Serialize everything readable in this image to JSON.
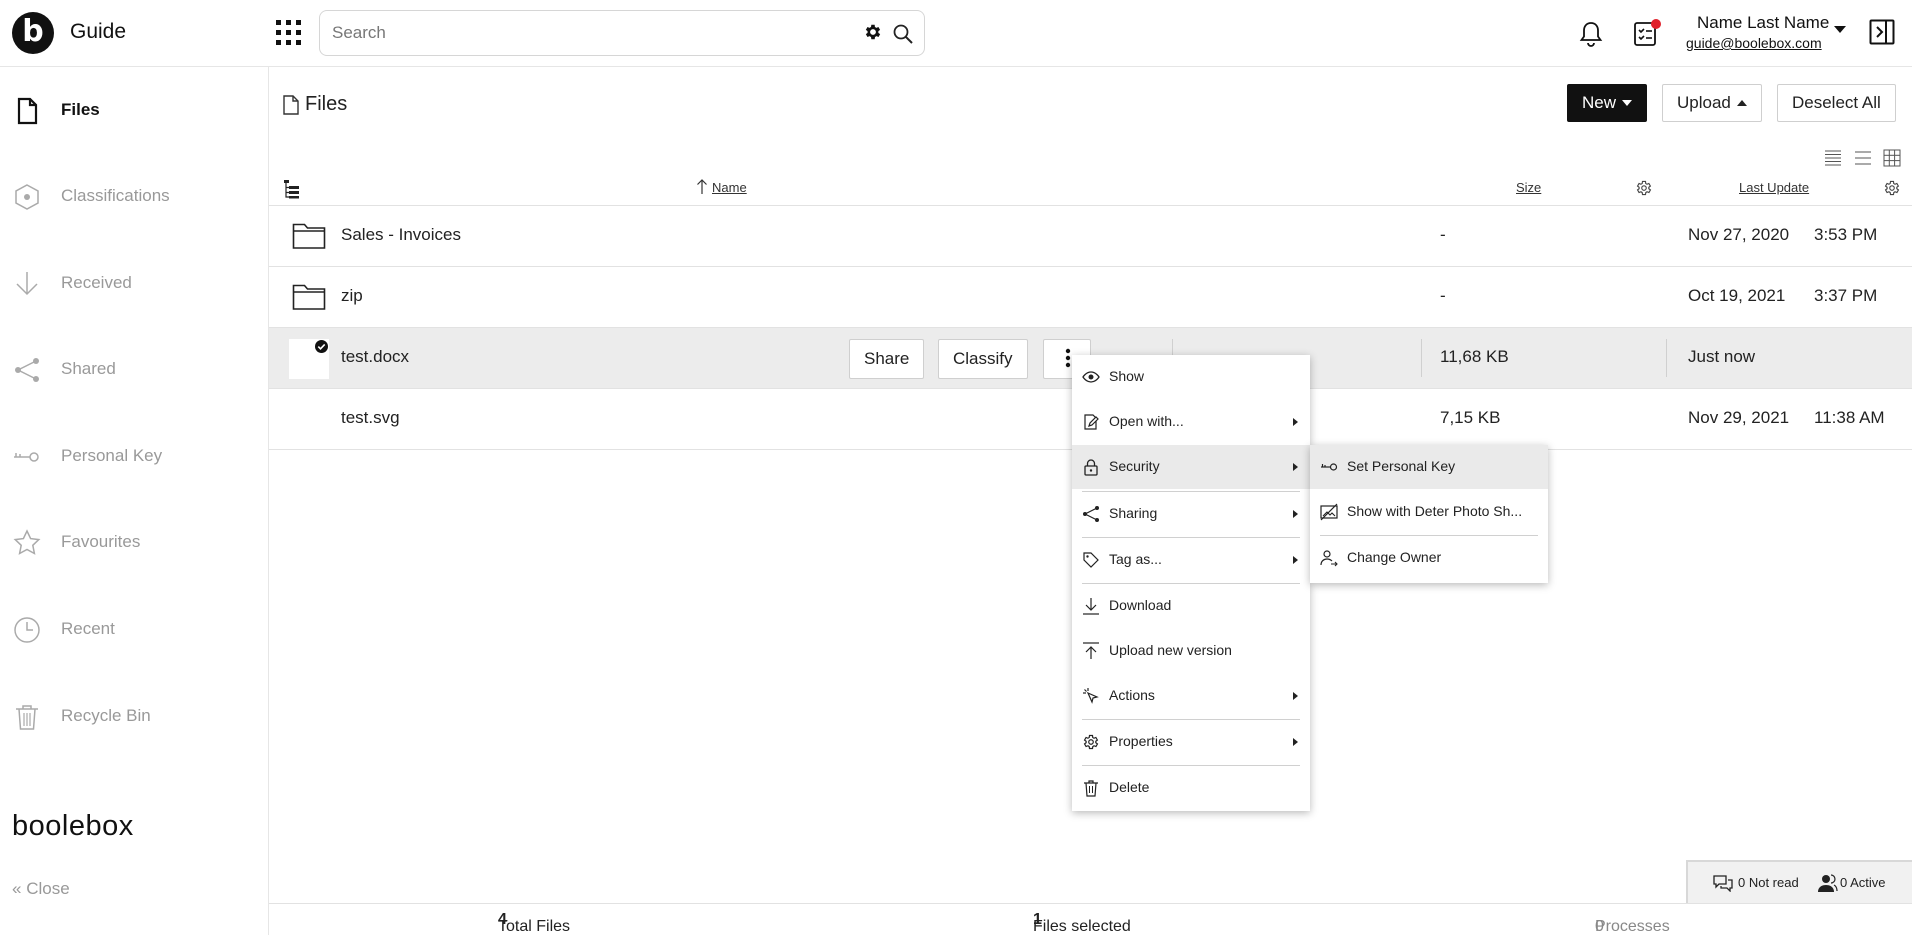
{
  "header": {
    "logo_letter": "b",
    "app_title": "Guide",
    "search_placeholder": "Search",
    "user_name": "Name Last Name",
    "user_email": "guide@boolebox.com"
  },
  "sidebar": {
    "items": [
      {
        "label": "Files",
        "icon": "file-icon",
        "active": true
      },
      {
        "label": "Classifications",
        "icon": "hexagon-icon"
      },
      {
        "label": "Received",
        "icon": "arrow-down-icon"
      },
      {
        "label": "Shared",
        "icon": "share-icon"
      },
      {
        "label": "Personal Key",
        "icon": "key-icon"
      },
      {
        "label": "Favourites",
        "icon": "star-icon"
      },
      {
        "label": "Recent",
        "icon": "clock-icon"
      },
      {
        "label": "Recycle Bin",
        "icon": "trash-icon"
      }
    ],
    "brand": "boolebox",
    "close_label": "Close"
  },
  "main": {
    "page_title": "Files",
    "new_label": "New",
    "upload_label": "Upload",
    "deselect_label": "Deselect All",
    "columns": {
      "name": "Name",
      "size": "Size",
      "last_update": "Last Update"
    },
    "rows": [
      {
        "name": "Sales - Invoices",
        "type": "folder",
        "size": "-",
        "date": "Nov 27, 2020",
        "time": "3:53 PM"
      },
      {
        "name": "zip",
        "type": "folder",
        "size": "-",
        "date": "Oct 19, 2021",
        "time": "3:37 PM"
      },
      {
        "name": "test.docx",
        "type": "file",
        "size": "11,68 KB",
        "date": "Just now",
        "time": "",
        "selected": true
      },
      {
        "name": "test.svg",
        "type": "file",
        "size": "7,15 KB",
        "date": "Nov 29, 2021",
        "time": "11:38 AM"
      }
    ],
    "row_share_label": "Share",
    "row_classify_label": "Classify"
  },
  "context_menu": {
    "items": [
      {
        "label": "Show",
        "icon": "eye-icon"
      },
      {
        "label": "Open with...",
        "icon": "edit-icon",
        "submenu": true
      },
      {
        "label": "Security",
        "icon": "lock-icon",
        "submenu": true,
        "highlighted": true
      },
      {
        "label": "Sharing",
        "icon": "share-icon",
        "submenu": true
      },
      {
        "label": "Tag as...",
        "icon": "tag-icon",
        "submenu": true
      },
      {
        "label": "Download",
        "icon": "download-icon"
      },
      {
        "label": "Upload new version",
        "icon": "upload-icon"
      },
      {
        "label": "Actions",
        "icon": "cursor-icon",
        "submenu": true
      },
      {
        "label": "Properties",
        "icon": "gear-icon",
        "submenu": true
      },
      {
        "label": "Delete",
        "icon": "trash-icon"
      }
    ]
  },
  "security_submenu": {
    "items": [
      {
        "label": "Set Personal Key",
        "icon": "key-icon",
        "highlighted": true
      },
      {
        "label": "Show with Deter Photo Sh...",
        "icon": "photo-off-icon"
      },
      {
        "label": "Change Owner",
        "icon": "user-change-icon"
      }
    ]
  },
  "footer": {
    "total_files_label": "Total Files",
    "total_files": "4",
    "files_selected_label": "Files selected",
    "files_selected": "1",
    "processes_count": "0",
    "processes_label": "Processes"
  },
  "chat": {
    "not_read": "0 Not read",
    "active": "0 Active"
  }
}
